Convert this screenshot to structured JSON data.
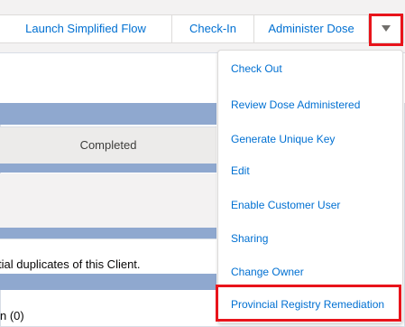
{
  "actions": {
    "launch": "Launch Simplified Flow",
    "checkin": "Check-In",
    "administer": "Administer Dose"
  },
  "status": {
    "completed": "Completed"
  },
  "page_text": {
    "duplicates": "tial duplicates of this Client.",
    "related": "n (0)"
  },
  "menu": {
    "items": [
      "Check Out",
      "Review Dose Administered",
      "Generate Unique Key",
      "Edit",
      "Enable Customer User",
      "Sharing",
      "Change Owner",
      "Provincial Registry Remediation"
    ]
  },
  "colors": {
    "link": "#0070d2",
    "highlight": "#e8141b",
    "band": "#8fa8cf"
  },
  "icons": {
    "more": "down-triangle-icon"
  }
}
